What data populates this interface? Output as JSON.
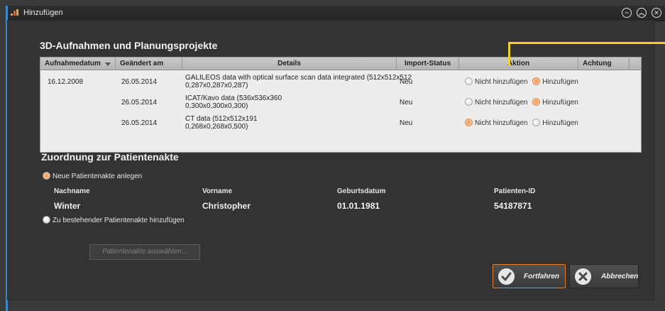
{
  "window": {
    "title": "Hinzufügen",
    "controls": [
      "minimize",
      "maximize",
      "close"
    ]
  },
  "section_3d": {
    "title": "3D-Aufnahmen und Planungsprojekte",
    "columns": [
      "Aufnahmedatum",
      "Geändert am",
      "Details",
      "Import-Status",
      "Aktion",
      "Achtung"
    ],
    "rows": [
      {
        "aufnahmedatum": "16.12.2008",
        "geaendert": "26.05.2014",
        "details_line1": "GALILEOS data with optical surface scan data integrated (512x512x512",
        "details_line2": "0,287x0,287x0,287)",
        "status": "Neu",
        "opt_no": "Nicht hinzufügen",
        "opt_yes": "Hinzufügen",
        "selected": "yes"
      },
      {
        "aufnahmedatum": "",
        "geaendert": "26.05.2014",
        "details_line1": "ICAT/Kavo data (536x536x360",
        "details_line2": "0,300x0,300x0,300)",
        "status": "Neu",
        "opt_no": "Nicht hinzufügen",
        "opt_yes": "Hinzufügen",
        "selected": "yes"
      },
      {
        "aufnahmedatum": "",
        "geaendert": "26.05.2014",
        "details_line1": "CT data (512x512x191",
        "details_line2": "0,268x0,268x0,500)",
        "status": "Neu",
        "opt_no": "Nicht hinzufügen",
        "opt_yes": "Hinzufügen",
        "selected": "no"
      }
    ]
  },
  "section_patient": {
    "title": "Zuordnung zur Patientenakte",
    "option_new": "Neue Patientenakte anlegen",
    "option_existing": "Zu bestehender Patientenakte hinzufügen",
    "selected": "new",
    "headers": {
      "nachname": "Nachname",
      "vorname": "Vorname",
      "geburtsdatum": "Geburtsdatum",
      "patienten_id": "Patienten-ID"
    },
    "values": {
      "nachname": "Winter",
      "vorname": "Christopher",
      "geburtsdatum": "01.01.1981",
      "patienten_id": "54187871"
    },
    "select_button": "Patientenakte auswählen..."
  },
  "buttons": {
    "continue": "Fortfahren",
    "cancel": "Abbrechen"
  },
  "colors": {
    "accent_orange": "#d97f37",
    "callout_yellow": "#f1cf2d",
    "window_border_blue": "#3d89c9"
  }
}
